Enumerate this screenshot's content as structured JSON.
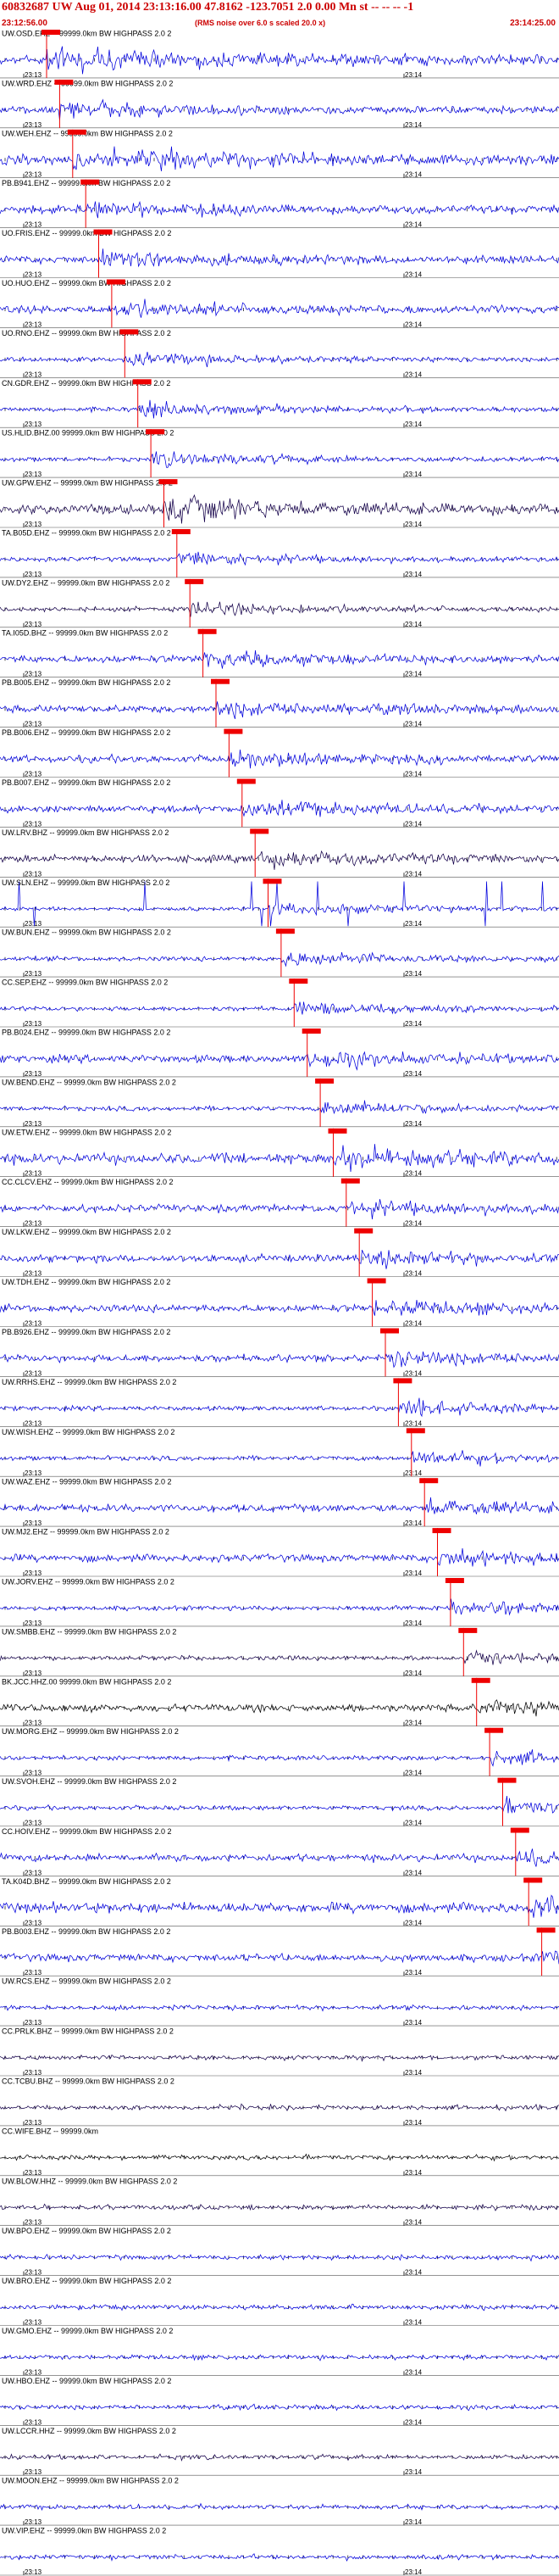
{
  "header": {
    "title": "60832687 UW Aug 01, 2014 23:13:16.00   47.8162 -123.7051  2.0 0.00 Mn st -- -- --  -1",
    "subtitle": "(RMS noise over 6.0 s scaled 20.0 x)",
    "start_time": "23:12:56.00",
    "end_time": "23:14:25.00"
  },
  "chart_data": {
    "type": "line",
    "tick_labels": [
      "23:13",
      "23:14"
    ],
    "colors": {
      "trace": "#0000dd",
      "trace_dark": "#14004a",
      "trace_black": "#000000",
      "pick": "#ee0000",
      "grid": "#000000",
      "header": "#cc0000"
    },
    "channels": [
      {
        "label": "UW.OSD.EHZ -- 99999.0km BW  HIGHPASS  2.0  2",
        "color": "trace",
        "pick": "P",
        "amp": "high"
      },
      {
        "label": "UW.WRD.EHZ -- 99999.0km BW  HIGHPASS  2.0  2",
        "color": "trace",
        "pick": "P",
        "amp": "med"
      },
      {
        "label": "UW.WEH.EHZ -- 99999.0km BW  HIGHPASS  2.0  2",
        "color": "trace",
        "pick": "P",
        "amp": "high"
      },
      {
        "label": "PB.B941.EHZ -- 99999.0km BW  HIGHPASS  2.0  2",
        "color": "trace",
        "pick": "P",
        "amp": "med"
      },
      {
        "label": "UO.FRIS.EHZ -- 99999.0km BW  HIGHPASS  2.0  2",
        "color": "trace",
        "pick": "P",
        "amp": "med"
      },
      {
        "label": "UO.HUO.EHZ -- 99999.0km BW  HIGHPASS  2.0  2",
        "color": "trace",
        "pick": "P",
        "amp": "med"
      },
      {
        "label": "UO.RNO.EHZ -- 99999.0km BW  HIGHPASS  2.0  2",
        "color": "trace",
        "pick": "P",
        "amp": "low"
      },
      {
        "label": "CN.GDR.EHZ -- 99999.0km BW  HIGHPASS  2.0  2",
        "color": "trace",
        "pick": "P",
        "amp": "low"
      },
      {
        "label": "US.HLID.BHZ.00 99999.0km BW  HIGHPASS  2.0  2",
        "color": "trace",
        "pick": "P",
        "amp": "low"
      },
      {
        "label": "UW.GPW.EHZ -- 99999.0km BW  HIGHPASS  2.0  2",
        "color": "trace_dark",
        "pick": "P",
        "amp": "high"
      },
      {
        "label": "TA.B05D.EHZ -- 99999.0km BW  HIGHPASS  2.0  2",
        "color": "trace",
        "pick": "P",
        "amp": "low"
      },
      {
        "label": "UW.DY2.EHZ -- 99999.0km BW  HIGHPASS  2.0  2",
        "color": "trace_dark",
        "pick": "P",
        "amp": "low"
      },
      {
        "label": "TA.I05D.BHZ -- 99999.0km BW  HIGHPASS  2.0  2",
        "color": "trace",
        "pick": "P",
        "amp": "med"
      },
      {
        "label": "PB.B005.EHZ -- 99999.0km BW  HIGHPASS  2.0  2",
        "color": "trace",
        "pick": "P",
        "amp": "med"
      },
      {
        "label": "PB.B006.EHZ -- 99999.0km BW  HIGHPASS  2.0  2",
        "color": "trace",
        "pick": "P",
        "amp": "med"
      },
      {
        "label": "PB.B007.EHZ -- 99999.0km BW  HIGHPASS  2.0  2",
        "color": "trace",
        "pick": "P",
        "amp": "med"
      },
      {
        "label": "UW.LRV.BHZ -- 99999.0km BW  HIGHPASS  2.0  2",
        "color": "trace_dark",
        "pick": "P",
        "amp": "med"
      },
      {
        "label": "UW.SLN.EHZ -- 99999.0km BW  HIGHPASS  2.0  2",
        "color": "trace",
        "pick": "P",
        "amp": "spiky"
      },
      {
        "label": "UW.BUN.EHZ -- 99999.0km BW  HIGHPASS  2.0  2",
        "color": "trace",
        "pick": "P",
        "amp": "low"
      },
      {
        "label": "CC.SEP.EHZ -- 99999.0km BW  HIGHPASS  2.0  2",
        "color": "trace",
        "pick": "P",
        "amp": "low"
      },
      {
        "label": "PB.B024.EHZ -- 99999.0km BW  HIGHPASS  2.0  2",
        "color": "trace",
        "pick": "P",
        "amp": "med"
      },
      {
        "label": "UW.BEND.EHZ -- 99999.0km BW  HIGHPASS  2.0  2",
        "color": "trace",
        "pick": "P",
        "amp": "low"
      },
      {
        "label": "UW.ETW.EHZ -- 99999.0km BW  HIGHPASS  2.0  2",
        "color": "trace",
        "pick": "P",
        "amp": "high"
      },
      {
        "label": "CC.CLCV.EHZ -- 99999.0km BW  HIGHPASS  2.0  2",
        "color": "trace",
        "pick": "P",
        "amp": "med"
      },
      {
        "label": "UW.LKW.EHZ -- 99999.0km BW  HIGHPASS  2.0  2",
        "color": "trace",
        "pick": "P",
        "amp": "med"
      },
      {
        "label": "UW.TDH.EHZ -- 99999.0km BW  HIGHPASS  2.0  2",
        "color": "trace",
        "pick": "P",
        "amp": "med"
      },
      {
        "label": "PB.B926.EHZ -- 99999.0km BW  HIGHPASS  2.0  2",
        "color": "trace",
        "pick": "P",
        "amp": "med"
      },
      {
        "label": "UW.RRHS.EHZ -- 99999.0km BW  HIGHPASS  2.0  2",
        "color": "trace",
        "pick": "P",
        "amp": "low"
      },
      {
        "label": "UW.WISH.EHZ -- 99999.0km BW  HIGHPASS  2.0  2",
        "color": "trace",
        "pick": "P",
        "amp": "low"
      },
      {
        "label": "UW.WAZ.EHZ -- 99999.0km BW  HIGHPASS  2.0  2",
        "color": "trace",
        "pick": "P",
        "amp": "med"
      },
      {
        "label": "UW.MJ2.EHZ -- 99999.0km BW  HIGHPASS  2.0  2",
        "color": "trace",
        "pick": "P",
        "amp": "med"
      },
      {
        "label": "UW.JORV.EHZ -- 99999.0km BW  HIGHPASS  2.0  2",
        "color": "trace",
        "pick": "P",
        "amp": "low"
      },
      {
        "label": "UW.SMBB.EHZ -- 99999.0km BW  HIGHPASS  2.0  2",
        "color": "trace_dark",
        "pick": "P",
        "amp": "low"
      },
      {
        "label": "BK.JCC.HHZ.00 99999.0km BW  HIGHPASS  2.0  2",
        "color": "trace_black",
        "pick": "P",
        "amp": "med"
      },
      {
        "label": "UW.MORG.EHZ -- 99999.0km BW  HIGHPASS  2.0  2",
        "color": "trace",
        "pick": "P",
        "amp": "low"
      },
      {
        "label": "UW.SVOH.EHZ -- 99999.0km BW  HIGHPASS  2.0  2",
        "color": "trace",
        "pick": "P",
        "amp": "low"
      },
      {
        "label": "CC.HOIV.EHZ -- 99999.0km BW  HIGHPASS  2.0  2",
        "color": "trace",
        "pick": "P",
        "amp": "med"
      },
      {
        "label": "TA.K04D.BHZ -- 99999.0km BW  HIGHPASS  2.0  2",
        "color": "trace",
        "pick": "P",
        "amp": "high"
      },
      {
        "label": "PB.B003.EHZ -- 99999.0km BW  HIGHPASS  2.0  2",
        "color": "trace",
        "pick": "P",
        "amp": "med"
      },
      {
        "label": "UW.RCS.EHZ -- 99999.0km BW  HIGHPASS  2.0  2",
        "color": "trace",
        "pick": "",
        "amp": "low"
      },
      {
        "label": "CC.PRLK.BHZ -- 99999.0km BW  HIGHPASS  2.0  2",
        "color": "trace_dark",
        "pick": "",
        "amp": "low"
      },
      {
        "label": "CC.TCBU.BHZ -- 99999.0km BW  HIGHPASS  2.0  2",
        "color": "trace_dark",
        "pick": "",
        "amp": "low"
      },
      {
        "label": "CC.WIFE.BHZ -- 99999.0km",
        "color": "trace_black",
        "pick": "",
        "amp": "low"
      },
      {
        "label": "UW.BLOW.HHZ -- 99999.0km BW  HIGHPASS  2.0  2",
        "color": "trace_dark",
        "pick": "",
        "amp": "low"
      },
      {
        "label": "UW.BPO.EHZ -- 99999.0km BW  HIGHPASS  2.0  2",
        "color": "trace",
        "pick": "",
        "amp": "low"
      },
      {
        "label": "UW.BRO.EHZ -- 99999.0km BW  HIGHPASS  2.0  2",
        "color": "trace",
        "pick": "",
        "amp": "low"
      },
      {
        "label": "UW.GMO.EHZ -- 99999.0km BW  HIGHPASS  2.0  2",
        "color": "trace",
        "pick": "",
        "amp": "low"
      },
      {
        "label": "UW.HBO.EHZ -- 99999.0km BW  HIGHPASS  2.0  2",
        "color": "trace",
        "pick": "",
        "amp": "low"
      },
      {
        "label": "UW.LCCR.HHZ -- 99999.0km BW  HIGHPASS  2.0  2",
        "color": "trace_dark",
        "pick": "",
        "amp": "low"
      },
      {
        "label": "UW.MOON.EHZ -- 99999.0km BW  HIGHPASS  2.0  2",
        "color": "trace",
        "pick": "",
        "amp": "low"
      },
      {
        "label": "UW.VIP.EHZ -- 99999.0km BW  HIGHPASS  2.0  2",
        "color": "trace",
        "pick": "",
        "amp": "low"
      }
    ]
  }
}
